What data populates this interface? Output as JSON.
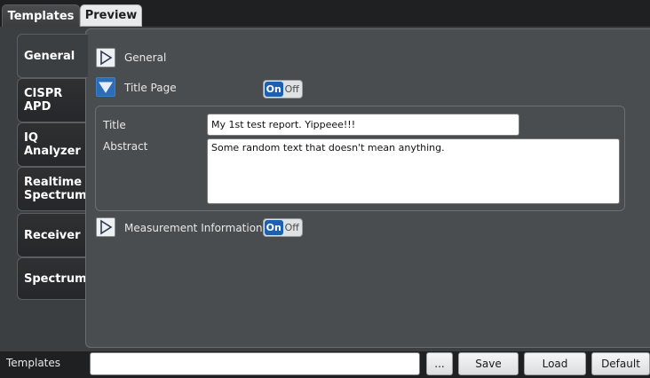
{
  "top_tabs": [
    {
      "label": "Templates",
      "active": true
    },
    {
      "label": "Preview",
      "active": false
    }
  ],
  "side_tabs": [
    {
      "label": "General",
      "active": true
    },
    {
      "label": "CISPR APD",
      "active": false
    },
    {
      "label": "IQ Analyzer",
      "active": false
    },
    {
      "label": "Realtime Spectrum",
      "active": false
    },
    {
      "label": "Receiver",
      "active": false
    },
    {
      "label": "Spectrum",
      "active": false
    }
  ],
  "sections": {
    "general": {
      "label": "General",
      "expanded": false
    },
    "title_page": {
      "label": "Title Page",
      "expanded": true,
      "toggle_on": "On",
      "toggle_off": "Off"
    },
    "measurement_info": {
      "label": "Measurement Information",
      "expanded": false,
      "toggle_on": "On",
      "toggle_off": "Off"
    }
  },
  "fields": {
    "title_label": "Title",
    "title_value": "My 1st test report. Yippeee!!!",
    "abstract_label": "Abstract",
    "abstract_value": "Some random text that doesn't mean anything."
  },
  "bottom_bar": {
    "label": "Templates",
    "input_value": "",
    "browse_label": "...",
    "save_label": "Save",
    "load_label": "Load",
    "default_label": "Default"
  },
  "colors": {
    "accent": "#1f5fb0",
    "panel_bg": "#3c3f41",
    "content_bg": "#4a4d4f"
  }
}
